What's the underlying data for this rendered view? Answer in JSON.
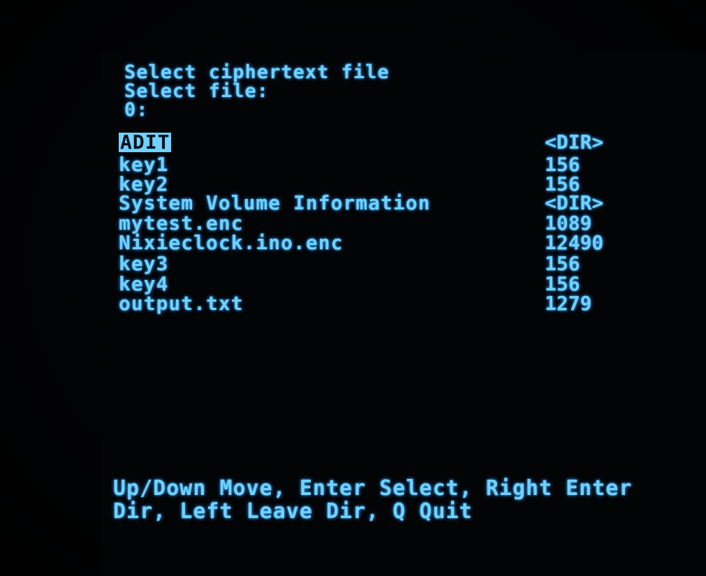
{
  "header": {
    "title": "Select ciphertext file",
    "prompt": "Select file:",
    "path": "0:"
  },
  "files": [
    {
      "name": "ADIT",
      "size": "<DIR>",
      "selected": true
    },
    {
      "name": "key1",
      "size": "156"
    },
    {
      "name": "key2",
      "size": "156"
    },
    {
      "name": "System Volume Information",
      "size": "<DIR>"
    },
    {
      "name": "mytest.enc",
      "size": "1089"
    },
    {
      "name": "Nixieclock.ino.enc",
      "size": "12490"
    },
    {
      "name": "key3",
      "size": "156"
    },
    {
      "name": "key4",
      "size": "156"
    },
    {
      "name": "output.txt",
      "size": "1279"
    }
  ],
  "footer": {
    "line1": "Up/Down Move, Enter Select, Right Enter",
    "line2": "Dir, Left Leave Dir, Q Quit"
  },
  "colors": {
    "phosphor": "#6fd2ff",
    "background": "#000000"
  }
}
